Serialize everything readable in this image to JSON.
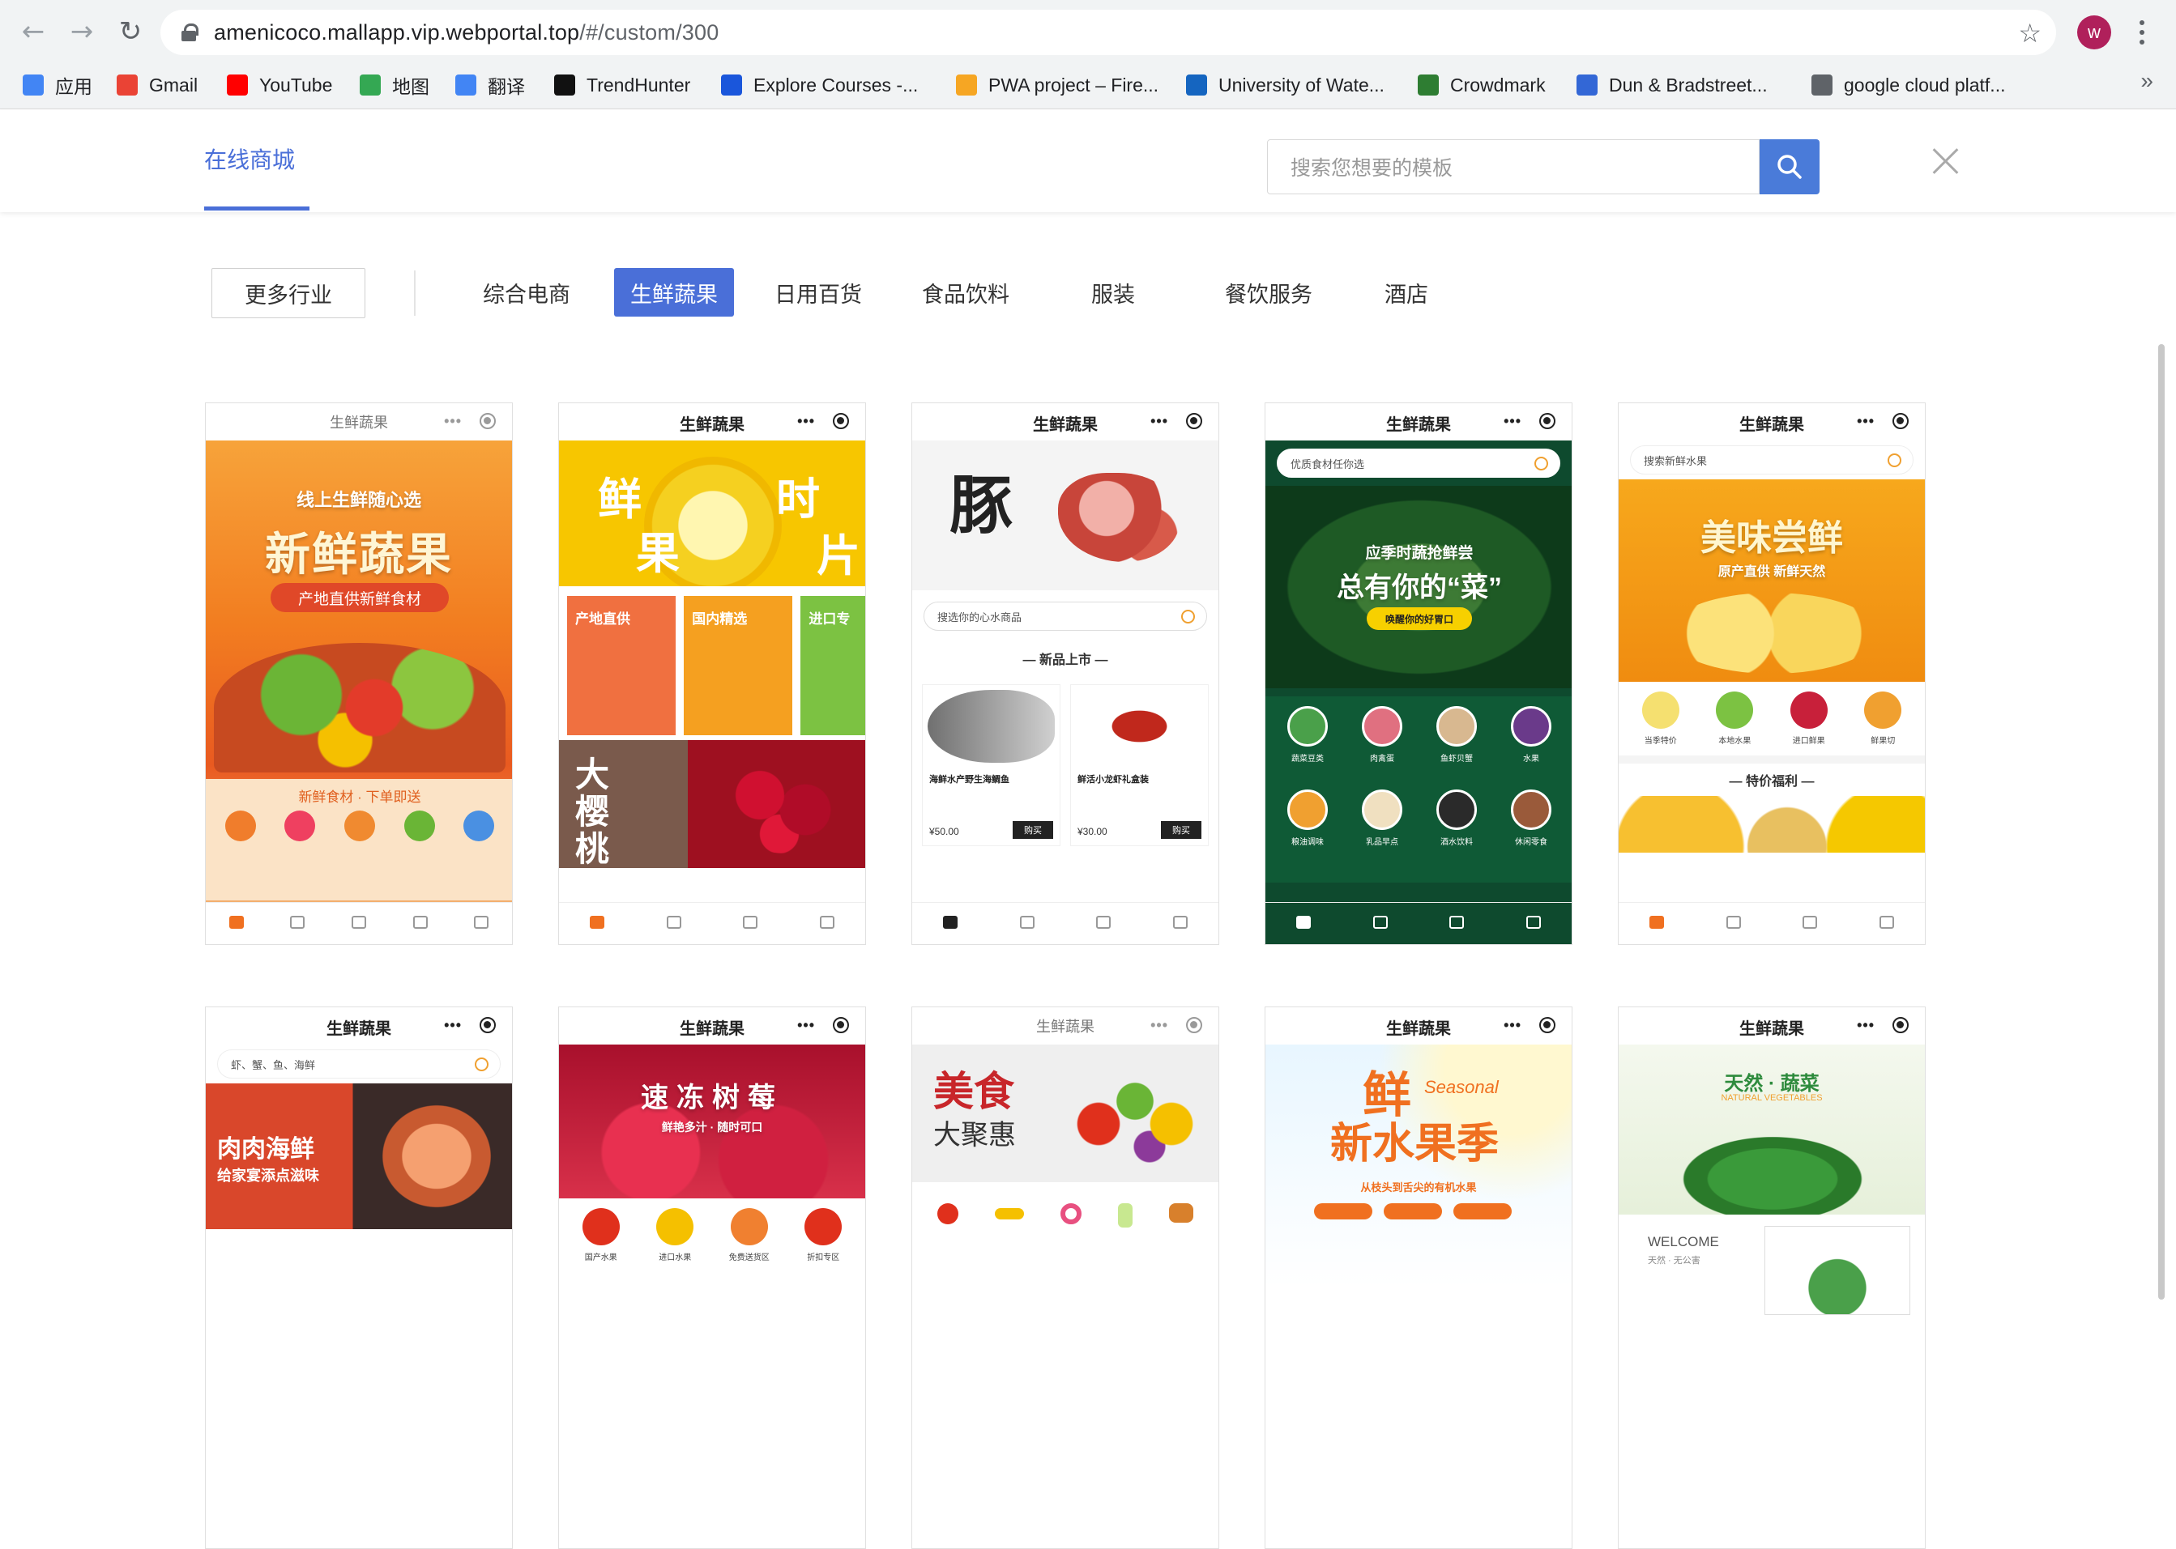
{
  "browser": {
    "url_host": "amenicoco.mallapp.vip.webportal.top",
    "url_path": "/#/custom/300",
    "profile_initial": "W",
    "bookmarks": [
      {
        "label": "应用",
        "icon": "apps-grid-icon",
        "color": "#4285f4"
      },
      {
        "label": "Gmail",
        "icon": "gmail-icon",
        "color": "#ea4335"
      },
      {
        "label": "YouTube",
        "icon": "youtube-icon",
        "color": "#ff0000"
      },
      {
        "label": "地图",
        "icon": "maps-pin-icon",
        "color": "#34a853"
      },
      {
        "label": "翻译",
        "icon": "translate-icon",
        "color": "#4285f4"
      },
      {
        "label": "TrendHunter",
        "icon": "trendhunter-icon",
        "color": "#111111"
      },
      {
        "label": "Explore Courses -...",
        "icon": "courses-icon",
        "color": "#1a56db"
      },
      {
        "label": "PWA project – Fire...",
        "icon": "firebase-icon",
        "color": "#f6a623"
      },
      {
        "label": "University of Wate...",
        "icon": "uwaterloo-icon",
        "color": "#1565c0"
      },
      {
        "label": "Crowdmark",
        "icon": "crowdmark-icon",
        "color": "#2e7d32"
      },
      {
        "label": "Dun & Bradstreet...",
        "icon": "dnb-icon",
        "color": "#3367d6"
      },
      {
        "label": "google cloud platf...",
        "icon": "gcp-icon",
        "color": "#5f6368"
      }
    ]
  },
  "header": {
    "tab_label": "在线商城",
    "search_placeholder": "搜索您想要的模板"
  },
  "categories": {
    "more_label": "更多行业",
    "items": [
      "综合电商",
      "生鲜蔬果",
      "日用百货",
      "食品饮料",
      "服装",
      "餐饮服务",
      "酒店"
    ],
    "active": "生鲜蔬果"
  },
  "cards": [
    {
      "title": "生鲜蔬果",
      "banner_line1": "线上生鲜随心选",
      "banner_line2": "新鲜蔬果",
      "banner_line3": "产地直供新鲜食材",
      "footer_text": "新鲜食材 · 下单即送",
      "theme": "#f5892a"
    },
    {
      "title": "生鲜蔬果",
      "banner_line1": "鲜",
      "banner_line2": "果",
      "banner_line3": "时",
      "banner_line4": "片",
      "tile1": "产地直供",
      "tile2": "国内精选",
      "tile3": "进口专",
      "tile4": "大樱桃",
      "theme": "#f5c000"
    },
    {
      "title": "生鲜蔬果",
      "banner_line1": "豚",
      "search": "搜选你的心水商品",
      "section": "— 新品上市 —",
      "item1": "海鲜水产野生海鲷鱼",
      "item2": "鲜活小龙虾礼盒装",
      "price1": "¥50.00",
      "price2": "¥30.00",
      "buy": "购买",
      "theme": "#e8e8e8"
    },
    {
      "title": "生鲜蔬果",
      "search": "优质食材任你选",
      "banner_line1": "应季时蔬抢鲜尝",
      "banner_line2": "总有你的“菜”",
      "banner_btn": "唤醒你的好胃口",
      "cats": [
        "蔬菜豆类",
        "肉禽蛋",
        "鱼虾贝蟹",
        "水果",
        "粮油调味",
        "乳品早点",
        "酒水饮料",
        "休闲零食"
      ],
      "theme": "#0e4a2e"
    },
    {
      "title": "生鲜蔬果",
      "search": "搜索新鲜水果",
      "banner_line1": "美味尝鲜",
      "banner_line2": "原产直供 新鲜天然",
      "cats": [
        "当季特价",
        "本地水果",
        "进口鲜果",
        "鲜果切"
      ],
      "section": "— 特价福利 —",
      "theme": "#f5a623"
    },
    {
      "title": "生鲜蔬果",
      "search": "虾、蟹、鱼、海鲜",
      "banner_line1": "肉肉海鲜",
      "banner_line2": "给家宴添点滋味",
      "theme": "#d9472b"
    },
    {
      "title": "生鲜蔬果",
      "banner_line1": "速冻树莓",
      "banner_line2": "鲜艳多汁 · 随时可口",
      "cats": [
        "国产水果",
        "进口水果",
        "免费送货区",
        "折扣专区"
      ],
      "theme": "#c8193a"
    },
    {
      "title": "生鲜蔬果",
      "banner_line1": "美食",
      "banner_line2": "大聚惠",
      "theme": "#ededed"
    },
    {
      "title": "生鲜蔬果",
      "banner_line1": "鲜",
      "banner_line2": "新水果季",
      "banner_line3": "Seasonal",
      "sub": "从枝头到舌尖的有机水果",
      "theme": "#f07020"
    },
    {
      "title": "生鲜蔬果",
      "banner_line1": "天然 · 蔬菜",
      "banner_line2": "NATURAL VEGETABLES",
      "welcome": "WELCOME",
      "welcome_sub": "天然 · 无公害",
      "theme": "#2e8b3d"
    }
  ]
}
